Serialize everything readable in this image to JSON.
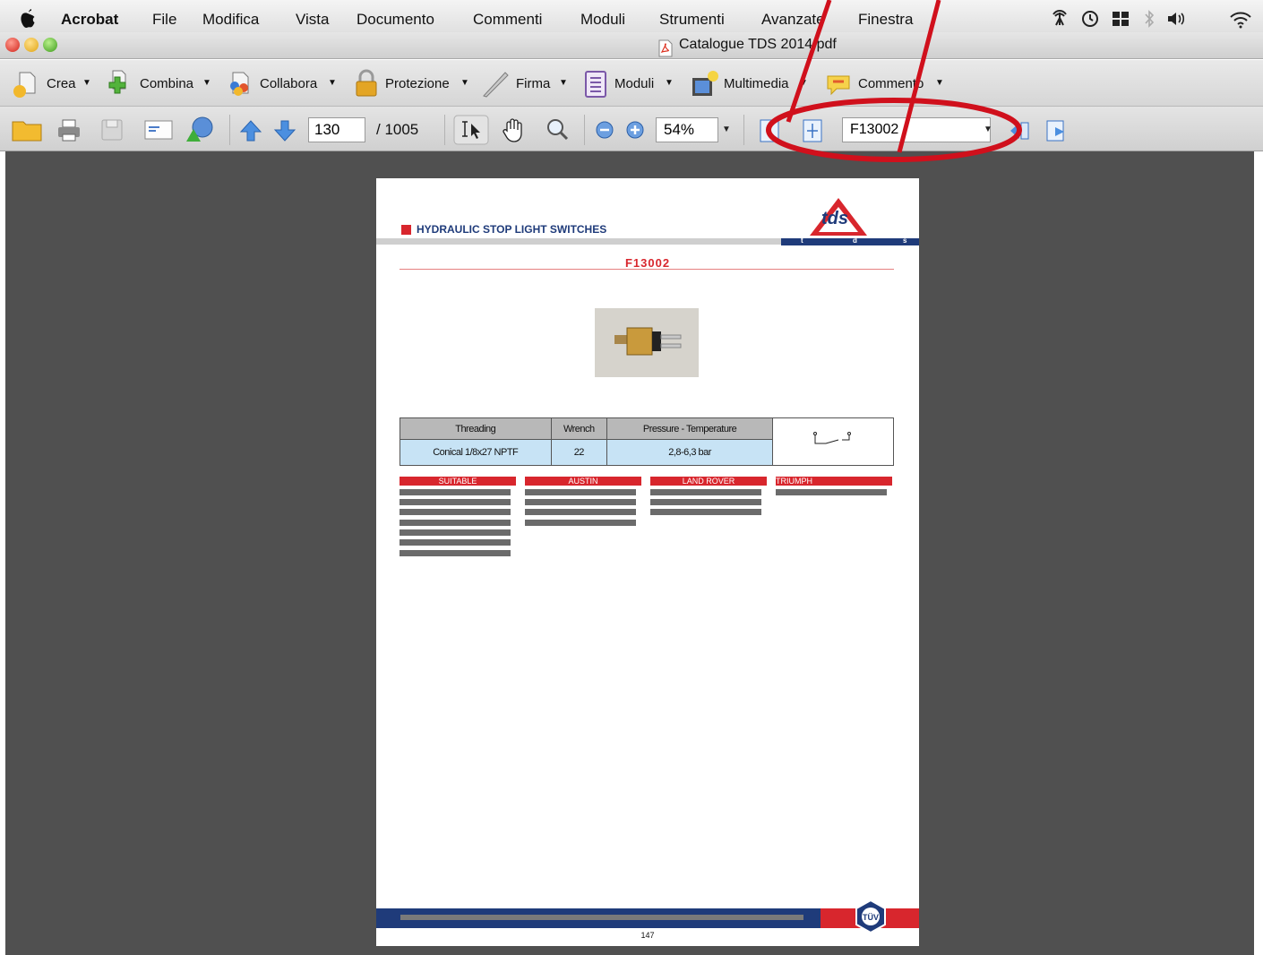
{
  "menubar": {
    "app_name": "Acrobat",
    "items": [
      "File",
      "Modifica",
      "Vista",
      "Documento",
      "Commenti",
      "Moduli",
      "Strumenti",
      "Avanzate",
      "Finestra"
    ]
  },
  "window": {
    "title": "Catalogue TDS 2014.pdf"
  },
  "toolbar1": {
    "buttons": [
      "Crea",
      "Combina",
      "Collabora",
      "Protezione",
      "Firma",
      "Moduli",
      "Multimedia",
      "Commento"
    ]
  },
  "toolbar2": {
    "page_number": "130",
    "page_total": "/ 1005",
    "zoom": "54%",
    "search_value": "F13002"
  },
  "document_page": {
    "heading": "HYDRAULIC STOP LIGHT SWITCHES",
    "logo_text": "tds",
    "band_letters": [
      "t",
      "d",
      "s"
    ],
    "product_code": "F13002",
    "table": {
      "headers": [
        "Threading",
        "Wrench",
        "Pressure - Temperature"
      ],
      "row": [
        "Conical 1/8x27 NPTF",
        "22",
        "2,8-6,3 bar"
      ]
    },
    "applications": [
      "SUITABLE",
      "AUSTIN",
      "LAND ROVER",
      "TRIUMPH"
    ],
    "page_number": "147",
    "footer_badge": "TÜV"
  },
  "colors": {
    "annotation": "#d0101c",
    "brand_red": "#d8262d",
    "brand_blue": "#1f3b7a",
    "viewer_bg": "#505050"
  }
}
